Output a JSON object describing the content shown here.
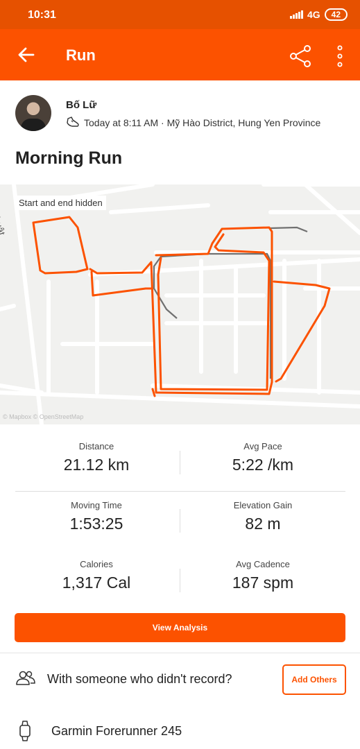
{
  "status_bar": {
    "time": "10:31",
    "network": "4G",
    "battery": "42"
  },
  "app_bar": {
    "title": "Run"
  },
  "athlete": {
    "name": "Bố Lữ",
    "meta": "Today at 8:11 AM · Mỹ Hào District, Hung Yen Province"
  },
  "activity": {
    "title": "Morning Run"
  },
  "map": {
    "privacy_label": "Start and end hidden",
    "street_label": "ên Thuật",
    "attribution": "© Mapbox © OpenStreetMap",
    "route_color": "#fc5200",
    "shadow_route_color": "#707070"
  },
  "stats": [
    {
      "label": "Distance",
      "value": "21.12 km"
    },
    {
      "label": "Avg Pace",
      "value": "5:22 /km"
    },
    {
      "label": "Moving Time",
      "value": "1:53:25"
    },
    {
      "label": "Elevation Gain",
      "value": "82 m"
    },
    {
      "label": "Calories",
      "value": "1,317 Cal"
    },
    {
      "label": "Avg Cadence",
      "value": "187 spm"
    }
  ],
  "actions": {
    "view_analysis": "View Analysis",
    "with_others_text": "With someone who didn't record?",
    "add_others": "Add Others"
  },
  "device": {
    "name": "Garmin Forerunner 245"
  },
  "icons": {
    "back": "arrow-left-icon",
    "share": "share-icon",
    "more": "more-vertical-icon",
    "shoe": "shoe-icon",
    "group": "group-icon",
    "watch": "watch-icon"
  },
  "colors": {
    "brand": "#fc5200",
    "status_bar": "#e65100"
  }
}
